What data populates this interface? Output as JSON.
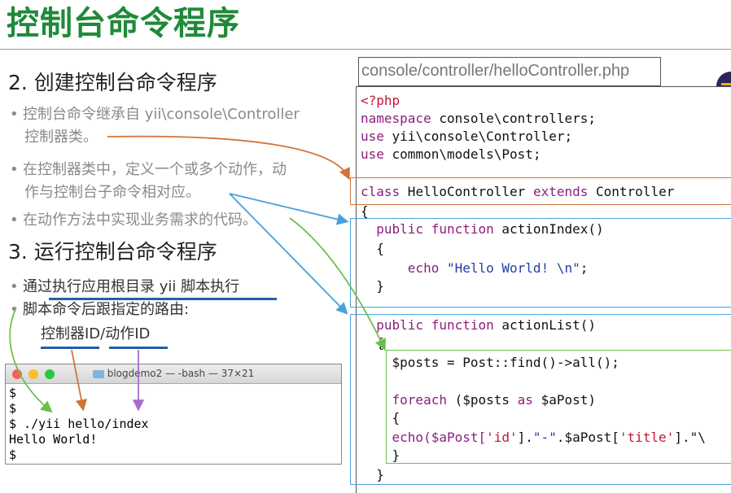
{
  "title": "控制台命令程序",
  "section2": {
    "heading": "2. 创建控制台命令程序",
    "bullets": [
      "控制台命令继承自 yii\\console\\Controller",
      "控制器类。",
      "在控制器类中，定义一个或多个动作，动",
      "作与控制台子命令相对应。",
      "在动作方法中实现业务需求的代码。"
    ]
  },
  "section3": {
    "heading": "3. 运行控制台命令程序",
    "bullets": [
      "通过执行应用根目录 yii 脚本执行",
      "脚本命令后跟指定的路由:"
    ],
    "route_controller": "控制器ID",
    "route_sep": "/",
    "route_action": "动作ID"
  },
  "file_tab": "console/controller/helloController.php",
  "code": {
    "l1": "<?php",
    "l2a": "namespace",
    "l2b": " console\\controllers;",
    "l3a": "use",
    "l3b": " yii\\console\\Controller;",
    "l4a": "use",
    "l4b": " common\\models\\Post;",
    "l6a": "class",
    "l6b": " HelloController ",
    "l6c": "extends",
    "l6d": " Controller",
    "l7": "{",
    "l8a": "  public function",
    "l8b": " actionIndex()",
    "l9": "  {",
    "l10a": "      echo ",
    "l10b": "\"Hello World! \\n\"",
    "l10c": ";",
    "l11": "  }",
    "l13a": "  public function",
    "l13b": " actionList()",
    "l14": "  {",
    "l15": "    $posts = Post::find()->all();",
    "l17a": "    foreach",
    "l17b": " ($posts ",
    "l17c": "as",
    "l17d": " $aPost)",
    "l18": "    {",
    "l19a": "    echo($aPost[",
    "l19b": "'id'",
    "l19c": "].",
    "l19d": "\"-\"",
    "l19e": ".$aPost[",
    "l19f": "'title'",
    "l19g": "].\"\\",
    "l20": "    }",
    "l21": "  }"
  },
  "terminal": {
    "title": "blogdemo2 — -bash — 37×21",
    "lines": [
      "$",
      "$",
      "$ ./yii hello/index",
      "Hello World!",
      "$"
    ]
  },
  "colors": {
    "title_green": "#1f8a3a",
    "orange": "#d2733a",
    "blue": "#4aa0dc",
    "green": "#6cc04a",
    "purple": "#a86cd0"
  }
}
